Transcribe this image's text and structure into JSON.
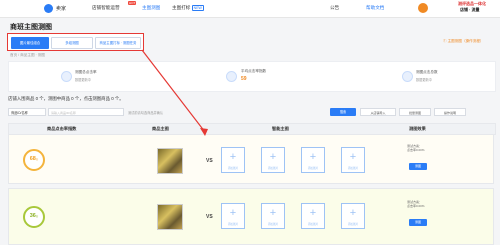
{
  "topbar": {
    "logo_text": "卖家",
    "nav": [
      "店铺智能运营",
      "主图测图",
      "主图打标"
    ],
    "hot_badge": "HOT",
    "new_tag": "NEW",
    "right_nav": [
      "公告",
      "帮助文档"
    ],
    "brand_line1": "测评选品一体化",
    "brand_line2": "店铺 · 流量"
  },
  "page_title": "商班主图测图",
  "tabs": [
    "图片最佳组合",
    "多组测图",
    "商品主图打标 · 测图任务"
  ],
  "help_link": "① 主图测图（操作流程）",
  "breadcrumb": "首页 / 商品主图 · 测图",
  "stats": [
    {
      "title": "测图总点击率",
      "sub": "数据更新中",
      "value": ""
    },
    {
      "title": "平均点击率指数",
      "sub": "",
      "value": "59"
    },
    {
      "title": "测图点击总数",
      "sub": "数据更新中",
      "value": ""
    }
  ],
  "notice": "店铺入围商品 0 个，测图中商品 0 个，点击测图商品 0 个。",
  "filter": {
    "select_value": "商品ID/名称",
    "search_placeholder": "请输入商品ID/名称",
    "hint": "测试前请勾选商品并确认",
    "search_btn": "搜索",
    "btns": [
      "从店铺导入",
      "批量测图",
      "操作说明"
    ]
  },
  "table": {
    "headers": [
      "商品点击率指数",
      "商品主图",
      "智能主图",
      "测图效果"
    ]
  },
  "rows": [
    {
      "score": "68",
      "score_unit": "分",
      "vs": "VS",
      "slot_label": "添加图片",
      "opt_text": [
        "测试方案：",
        "点击率0.00%"
      ],
      "opt_btn": "测图"
    },
    {
      "score": "36",
      "score_unit": "分",
      "vs": "VS",
      "slot_label": "添加图片",
      "opt_text": [
        "测试方案：",
        "点击率0.00%"
      ],
      "opt_btn": "测图"
    }
  ],
  "colors": {
    "accent": "#2a7cf6",
    "highlight_border": "#e53935",
    "score_orange": "#f4b43c",
    "score_green": "#a8c83a"
  }
}
